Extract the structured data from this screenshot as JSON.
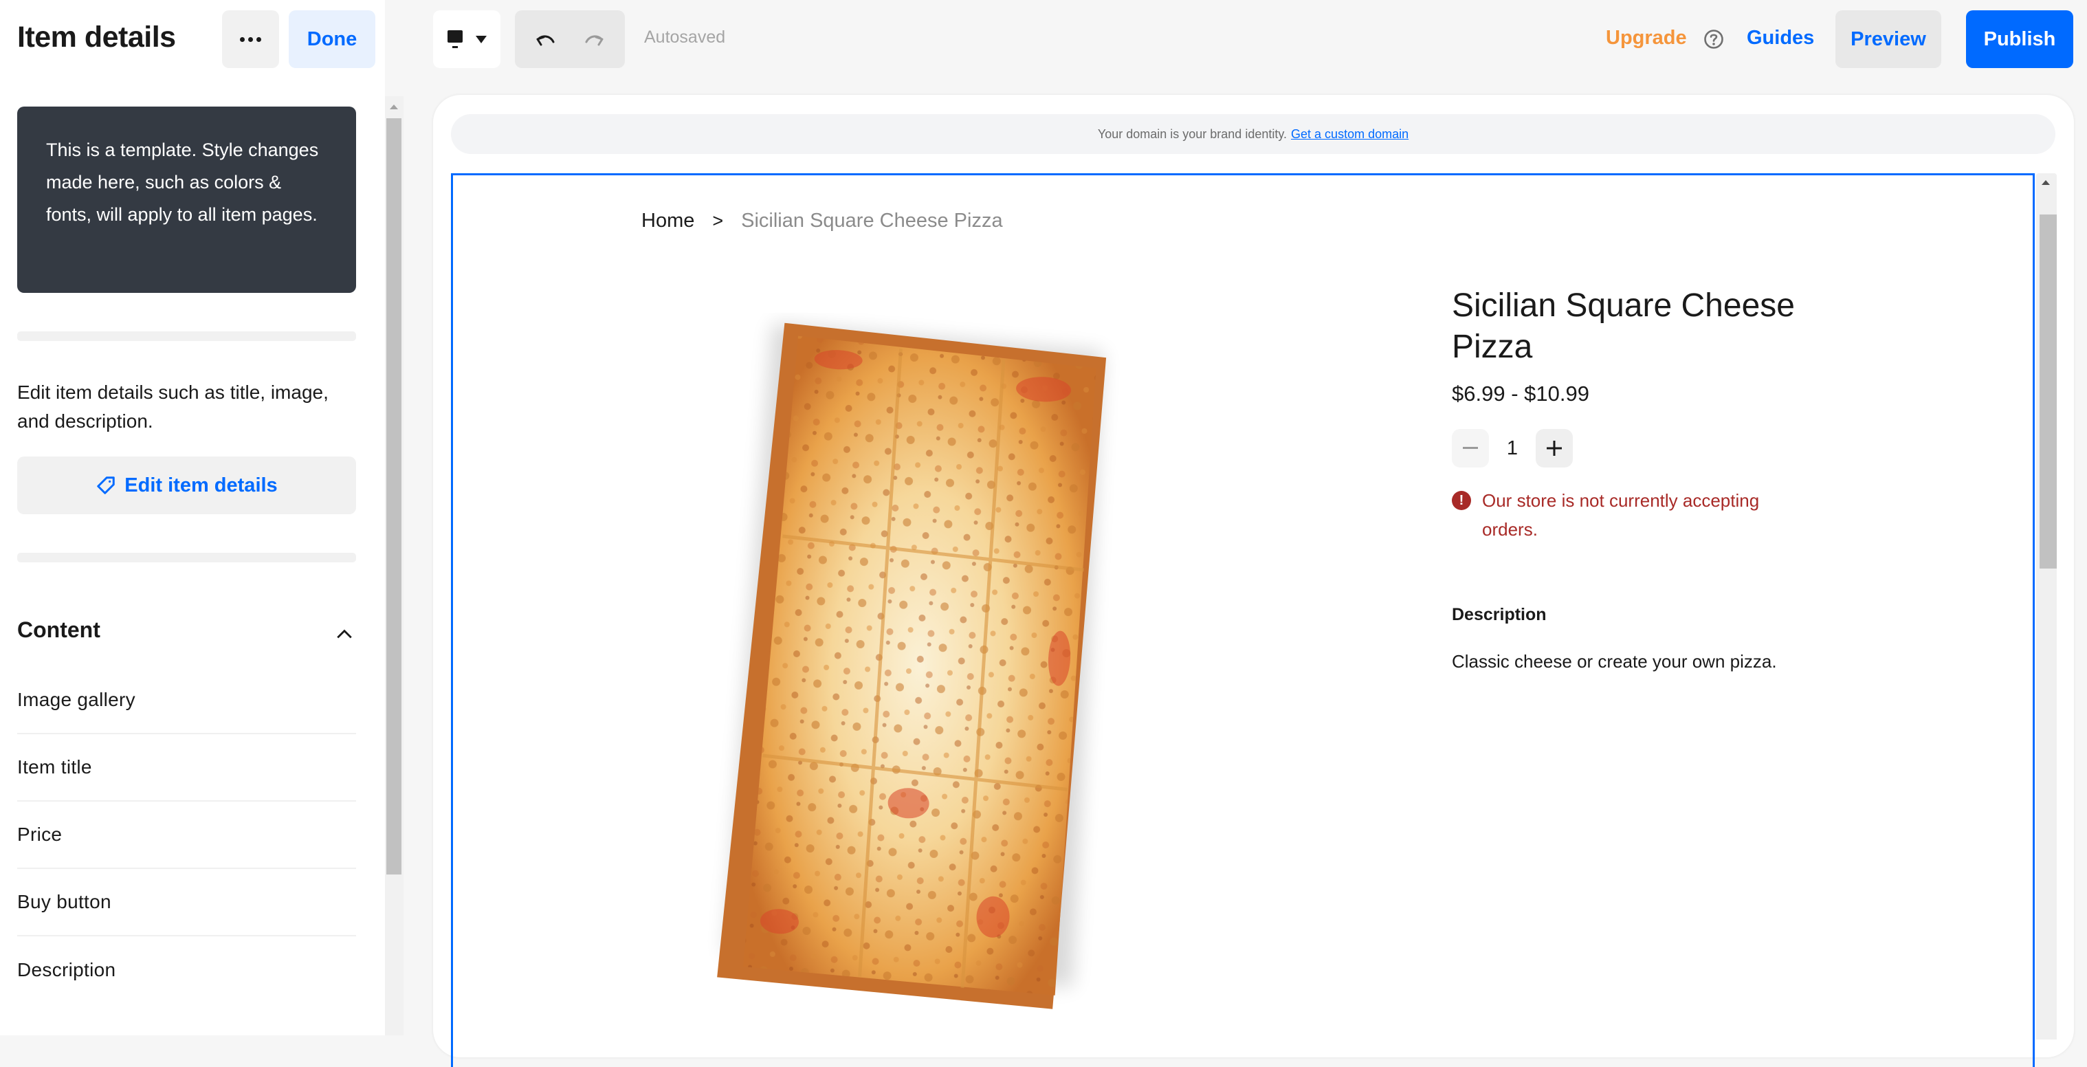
{
  "panel": {
    "title": "Item details",
    "more_label": "More options",
    "done_label": "Done",
    "template_notice": "This is a template. Style changes made here, such as colors & fonts, will apply to all item pages.",
    "edit_description": "Edit item details such as title, image, and description.",
    "edit_button_label": "Edit item details",
    "content_section": {
      "title": "Content",
      "expanded": true,
      "items": [
        {
          "label": "Image gallery"
        },
        {
          "label": "Item title"
        },
        {
          "label": "Price"
        },
        {
          "label": "Buy button"
        },
        {
          "label": "Description"
        }
      ]
    }
  },
  "toolbar": {
    "device_icon": "desktop-icon",
    "autosave_status": "Autosaved",
    "upgrade_label": "Upgrade",
    "help_icon": "question-circle-icon",
    "guides_label": "Guides",
    "preview_label": "Preview",
    "publish_label": "Publish"
  },
  "preview": {
    "domain_banner": {
      "text": "Your domain is your brand identity.",
      "link_label": "Get a custom domain"
    },
    "breadcrumb": {
      "home": "Home",
      "separator": ">",
      "current": "Sicilian Square Cheese Pizza"
    },
    "product": {
      "image_alt": "Sicilian square cheese pizza",
      "title": "Sicilian Square Cheese Pizza",
      "price": "$6.99 - $10.99",
      "quantity": "1",
      "error_message": "Our store is not currently accepting orders.",
      "description_heading": "Description",
      "description_text": "Classic cheese or create your own pizza."
    }
  },
  "colors": {
    "accent": "#006aff",
    "upgrade": "#f5953b",
    "error": "#a82a27",
    "tip_bg": "#343a43"
  }
}
